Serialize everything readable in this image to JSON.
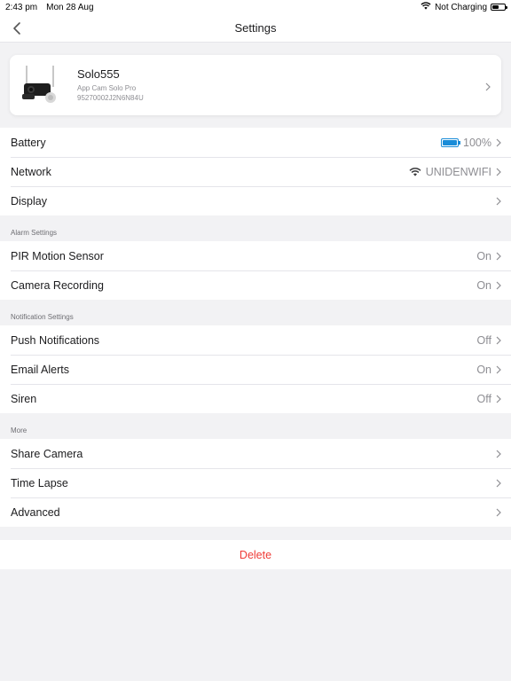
{
  "status": {
    "time": "2:43 pm",
    "date": "Mon 28 Aug",
    "charging": "Not Charging"
  },
  "nav": {
    "title": "Settings"
  },
  "device": {
    "name": "Solo555",
    "model": "App Cam Solo Pro",
    "serial": "95270002J2N6N84U"
  },
  "general": {
    "battery_label": "Battery",
    "battery_value": "100%",
    "network_label": "Network",
    "network_value": "UNIDENWIFI",
    "display_label": "Display"
  },
  "alarm": {
    "header": "Alarm Settings",
    "pir_label": "PIR Motion Sensor",
    "pir_value": "On",
    "rec_label": "Camera Recording",
    "rec_value": "On"
  },
  "notification": {
    "header": "Notification Settings",
    "push_label": "Push Notifications",
    "push_value": "Off",
    "email_label": "Email Alerts",
    "email_value": "On",
    "siren_label": "Siren",
    "siren_value": "Off"
  },
  "more": {
    "header": "More",
    "share_label": "Share Camera",
    "timelapse_label": "Time Lapse",
    "advanced_label": "Advanced"
  },
  "delete_label": "Delete",
  "colors": {
    "accent_blue": "#1a8cd8",
    "delete_red": "#ef3b36",
    "background": "#f2f2f4"
  }
}
